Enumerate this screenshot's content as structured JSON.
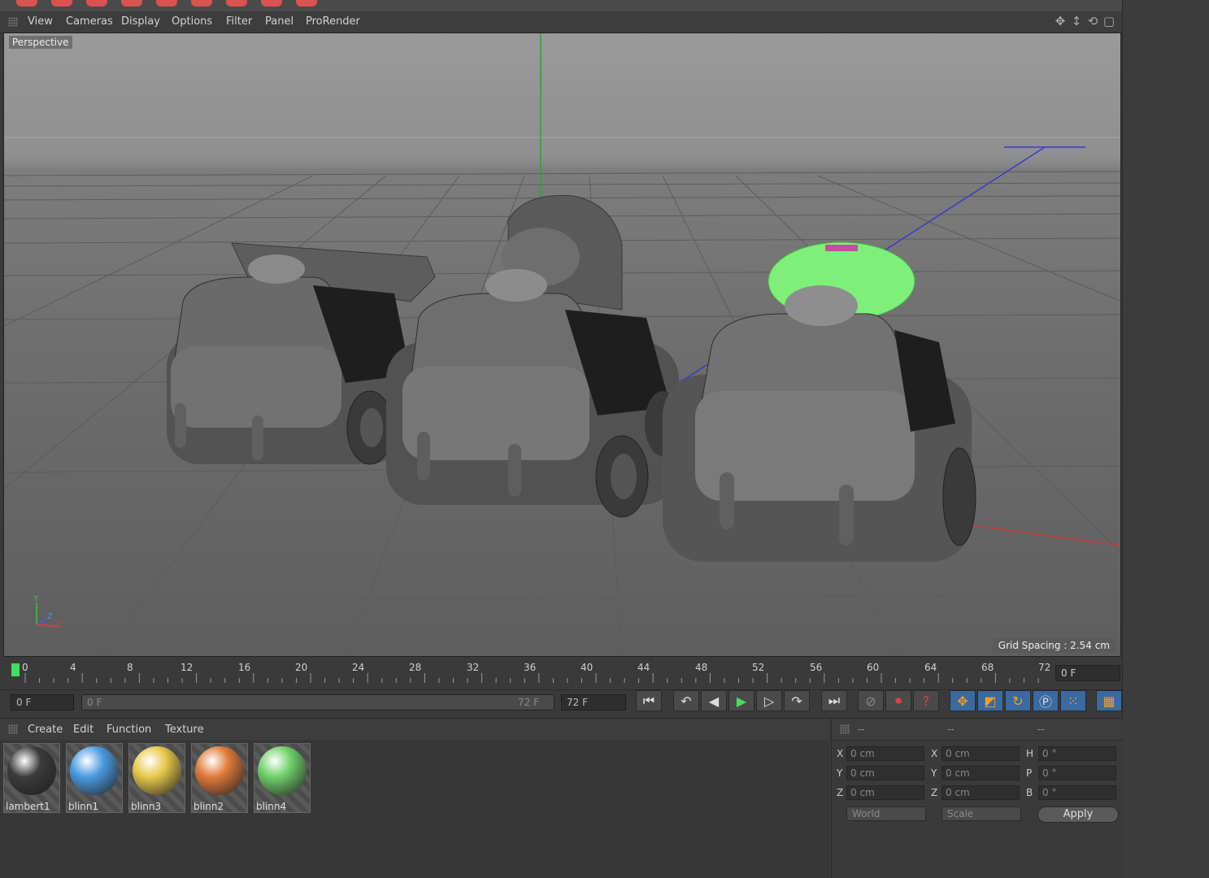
{
  "viewport_menu": [
    "View",
    "Cameras",
    "Display",
    "Options",
    "Filter",
    "Panel",
    "ProRender"
  ],
  "viewport": {
    "camera_label": "Perspective",
    "grid_spacing": "Grid Spacing : 2.54 cm",
    "axis_labels": {
      "y": "Y",
      "z": "Z",
      "x": "X"
    }
  },
  "timeline": {
    "ticks": [
      "0",
      "4",
      "8",
      "12",
      "16",
      "20",
      "24",
      "28",
      "32",
      "36",
      "40",
      "44",
      "48",
      "52",
      "56",
      "60",
      "64",
      "68",
      "72"
    ],
    "current_frame": "0 F"
  },
  "transport": {
    "start_field": "0 F",
    "range_start": "0 F",
    "range_end": "72 F",
    "end_field": "72 F"
  },
  "material_menu": [
    "Create",
    "Edit",
    "Function",
    "Texture"
  ],
  "materials": [
    {
      "name": "lambert1",
      "color": "#3b3b3b"
    },
    {
      "name": "blinn1",
      "color": "#4a9be0"
    },
    {
      "name": "blinn3",
      "color": "#e8c84a"
    },
    {
      "name": "blinn2",
      "color": "#e07a3a"
    },
    {
      "name": "blinn4",
      "color": "#6fd06a"
    }
  ],
  "coordinates": {
    "header": [
      "--",
      "--",
      "--"
    ],
    "rows": [
      {
        "pos_label": "X",
        "pos": "0 cm",
        "size_label": "X",
        "size": "0 cm",
        "rot_label": "H",
        "rot": "0 °"
      },
      {
        "pos_label": "Y",
        "pos": "0 cm",
        "size_label": "Y",
        "size": "0 cm",
        "rot_label": "P",
        "rot": "0 °"
      },
      {
        "pos_label": "Z",
        "pos": "0 cm",
        "size_label": "Z",
        "size": "0 cm",
        "rot_label": "B",
        "rot": "0 °"
      }
    ],
    "mode_dropdown": "World",
    "scale_dropdown": "Scale",
    "apply_label": "Apply"
  }
}
